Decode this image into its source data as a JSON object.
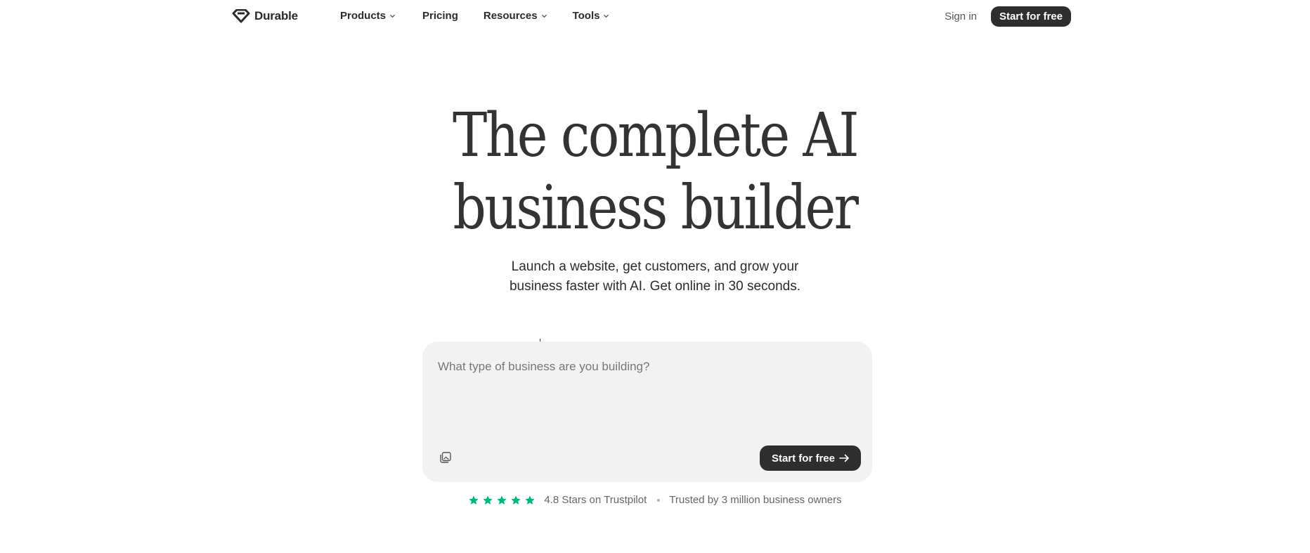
{
  "nav": {
    "brand": "Durable",
    "links": [
      {
        "label": "Products",
        "has_dropdown": true
      },
      {
        "label": "Pricing",
        "has_dropdown": false
      },
      {
        "label": "Resources",
        "has_dropdown": true
      },
      {
        "label": "Tools",
        "has_dropdown": true
      }
    ],
    "signin_label": "Sign in",
    "cta_label": "Start for free"
  },
  "hero": {
    "title_line1": "The complete AI",
    "title_line2": "business builder",
    "subtitle_line1": "Launch a website, get customers, and grow your",
    "subtitle_line2": "business faster with AI. Get online in 30 seconds."
  },
  "prompt": {
    "placeholder": "What type of business are you building?",
    "value": "",
    "attach_icon": "attach-image-icon",
    "cta_label": "Start for free",
    "cta_icon": "arrow-right-icon"
  },
  "trust": {
    "rating": 5,
    "rating_text": "4.8 Stars on Trustpilot",
    "trusted_text": "Trusted by 3 million business owners",
    "star_color": "#00b67a"
  },
  "colors": {
    "dark_button": "#2e2e2e",
    "prompt_bg": "#f2f2f2",
    "text": "#2b2b2b"
  }
}
